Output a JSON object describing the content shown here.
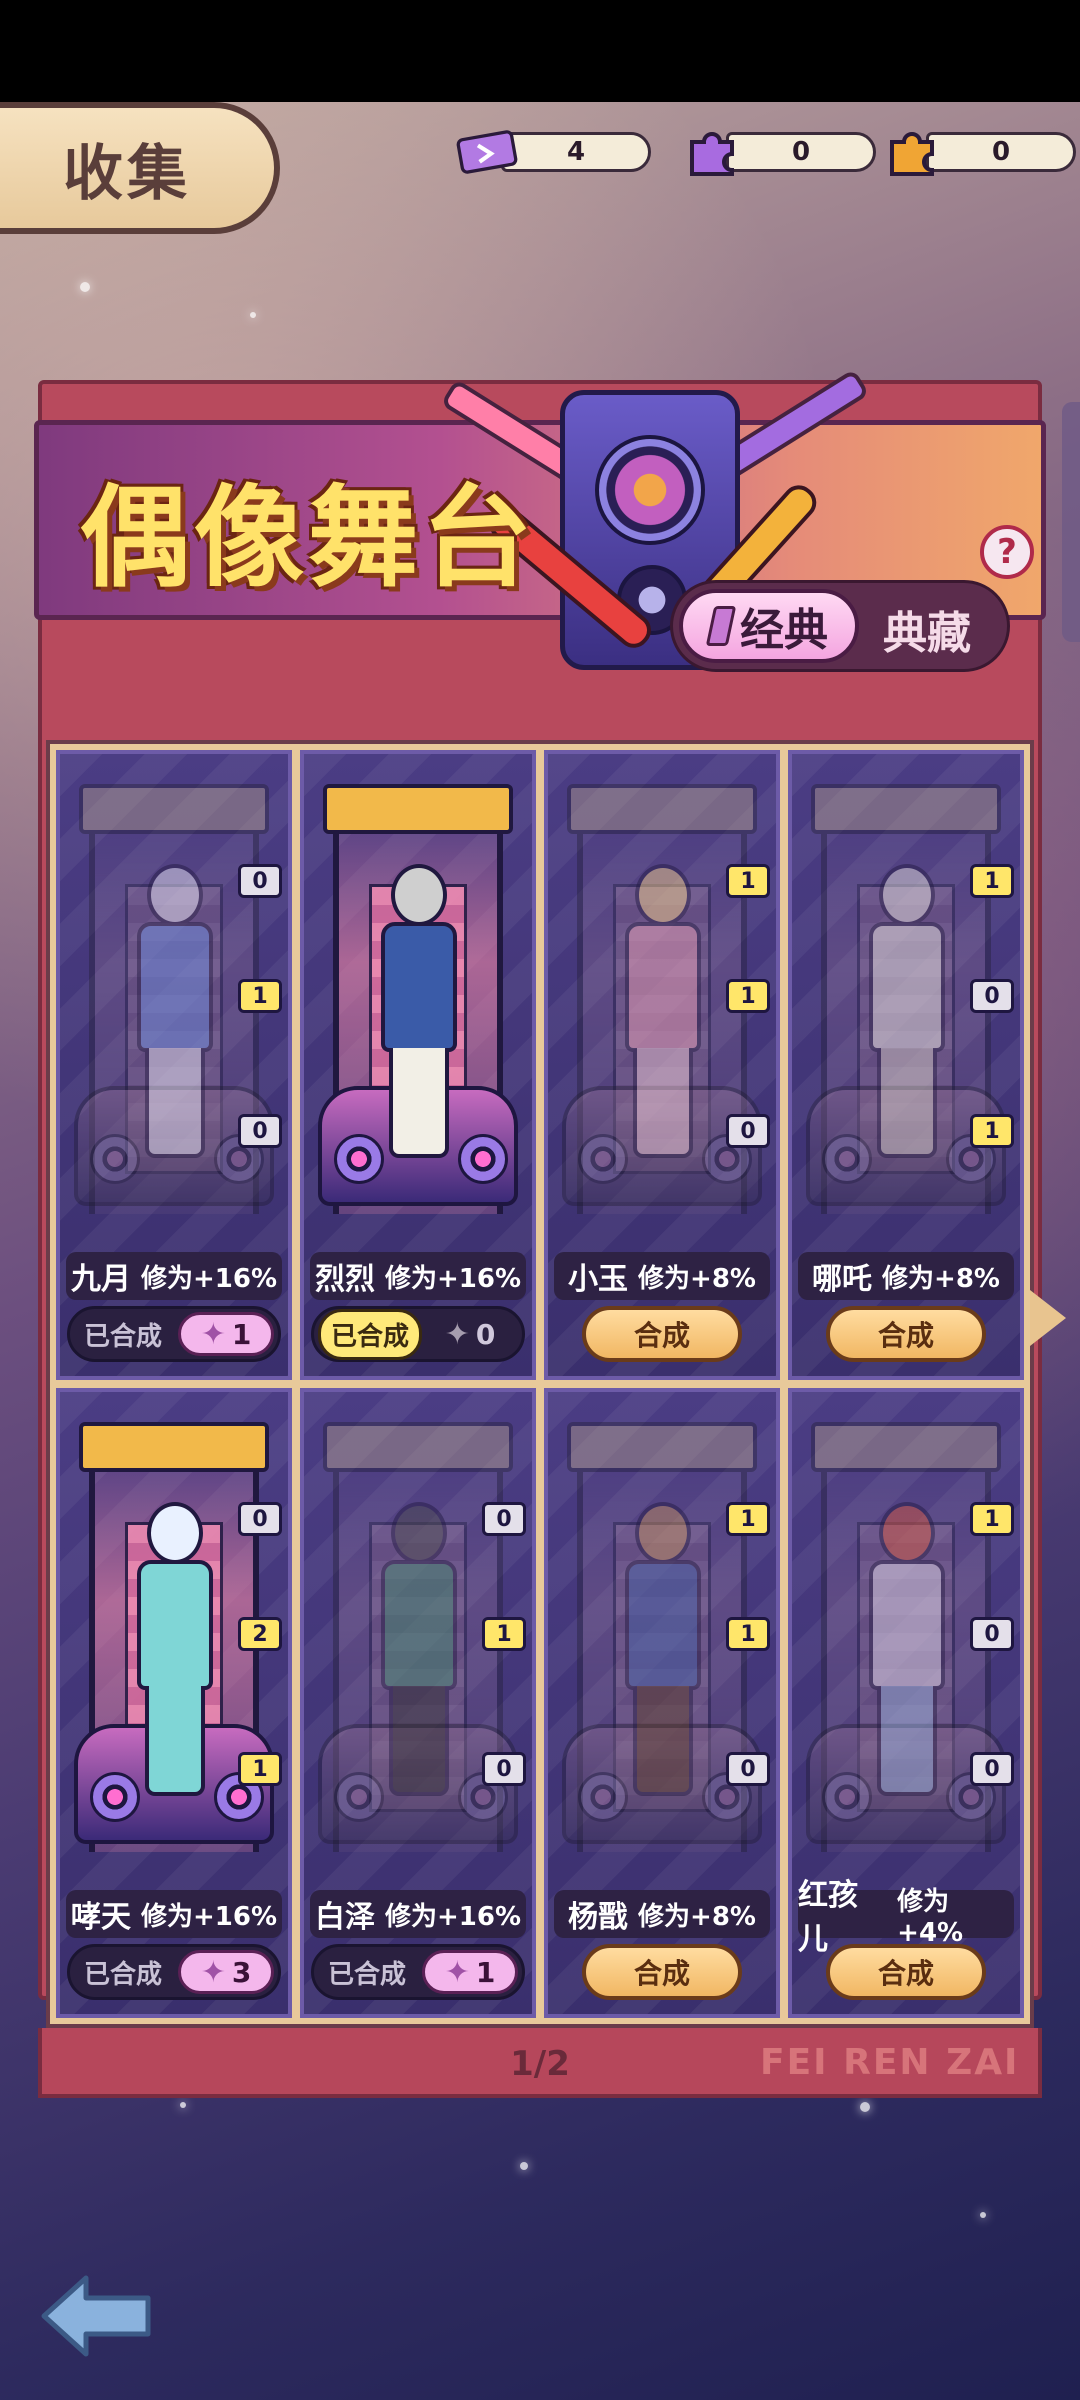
{
  "header": {
    "title": "收集",
    "resources": [
      {
        "icon": "ticket-icon",
        "value": "4"
      },
      {
        "icon": "purple-puzzle-icon",
        "value": "0"
      },
      {
        "icon": "orange-puzzle-icon",
        "value": "0"
      }
    ]
  },
  "banner": {
    "title": "偶像舞台",
    "mode_active": "经典",
    "mode_inactive": "典藏",
    "help": "?"
  },
  "cards": [
    {
      "name": "九月",
      "bonus": "修为+16%",
      "badges": [
        "0",
        "1",
        "0"
      ],
      "status": "已合成",
      "pieces": "1"
    },
    {
      "name": "烈烈",
      "bonus": "修为+16%",
      "badges": [
        "",
        ""
      ],
      "status": "已合成",
      "pieces": "0"
    },
    {
      "name": "小玉",
      "bonus": "修为+8%",
      "badges": [
        "1",
        "1",
        "0"
      ],
      "action": "合成"
    },
    {
      "name": "哪吒",
      "bonus": "修为+8%",
      "badges": [
        "1",
        "0",
        "1"
      ],
      "action": "合成"
    },
    {
      "name": "哮天",
      "bonus": "修为+16%",
      "badges": [
        "0",
        "2",
        "1"
      ],
      "status": "已合成",
      "pieces": "3"
    },
    {
      "name": "白泽",
      "bonus": "修为+16%",
      "badges": [
        "0",
        "1",
        "0"
      ],
      "status": "已合成",
      "pieces": "1"
    },
    {
      "name": "杨戬",
      "bonus": "修为+8%",
      "badges": [
        "1",
        "1",
        "0"
      ],
      "action": "合成"
    },
    {
      "name": "红孩儿",
      "bonus": "修为+4%",
      "badges": [
        "1",
        "0",
        "0"
      ],
      "action": "合成"
    }
  ],
  "pagination": {
    "label": "1/2"
  },
  "watermark": "FEI REN ZAI",
  "colors": {
    "accent_gold": "#ffe26a",
    "button_orange": "#f1b763",
    "badge_yellow": "#ffe66a",
    "piece_pink": "#f4b7ec"
  }
}
